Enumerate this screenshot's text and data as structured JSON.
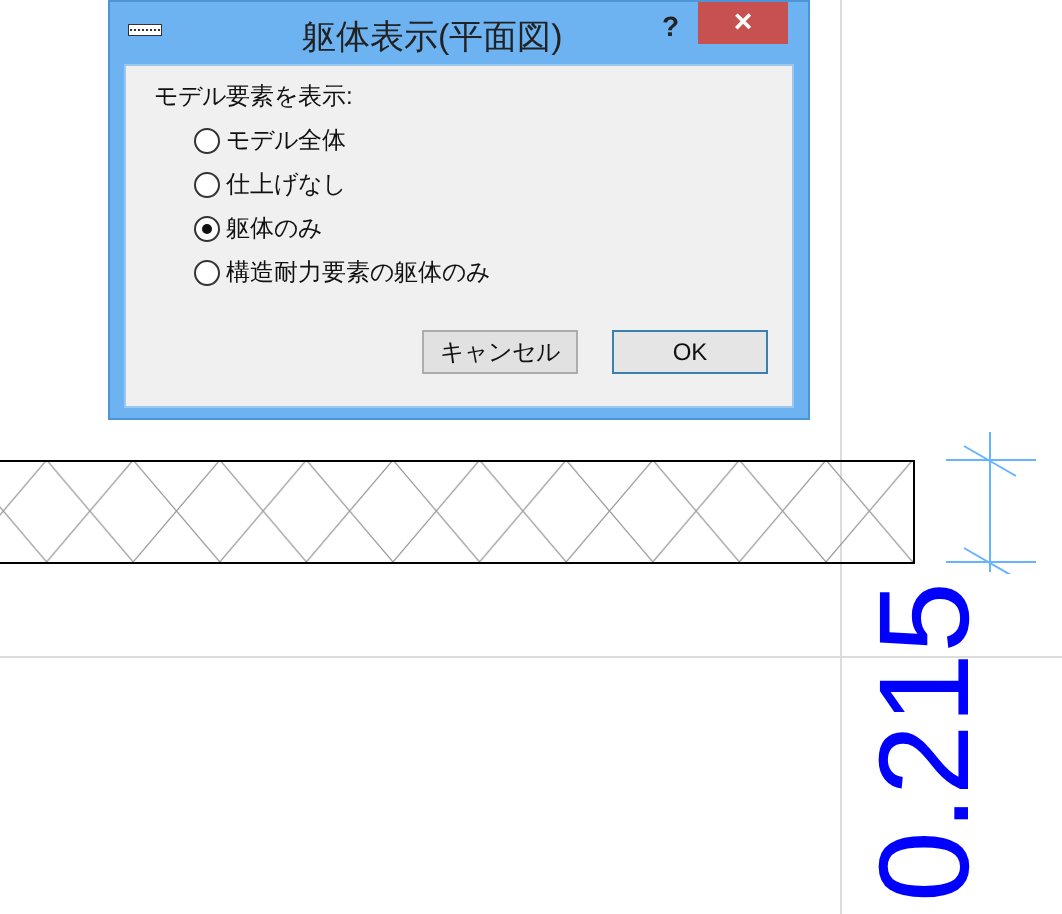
{
  "dialog": {
    "title": "躯体表示(平面図)",
    "help": "?",
    "close": "×",
    "group_label": "モデル要素を表示:",
    "options": [
      {
        "label": "モデル全体",
        "selected": false
      },
      {
        "label": "仕上げなし",
        "selected": false
      },
      {
        "label": "躯体のみ",
        "selected": true
      },
      {
        "label": "構造耐力要素の躯体のみ",
        "selected": false
      }
    ],
    "buttons": [
      {
        "label": "キャンセル",
        "default": false
      },
      {
        "label": "OK",
        "default": true
      }
    ]
  },
  "drawing": {
    "dimension_text": "0.215"
  }
}
